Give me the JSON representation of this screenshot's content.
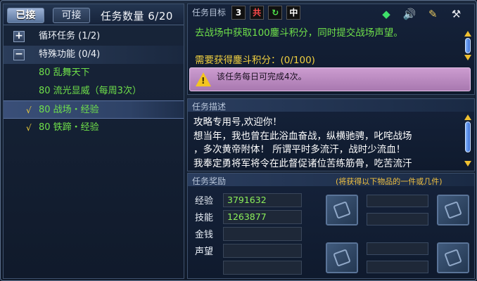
{
  "tabs": {
    "accepted": "已接",
    "available": "可接"
  },
  "task_count": "任务数量 6/20",
  "tree": {
    "groups": [
      {
        "toggle": "+",
        "label": "循环任务 (1/2)"
      },
      {
        "toggle": "−",
        "label": "特殊功能 (0/4)"
      }
    ],
    "quests": [
      {
        "check": "",
        "label": "80 乱舞天下"
      },
      {
        "check": "",
        "label": "80 流光显威（每周3次）"
      },
      {
        "check": "√",
        "label": "80 战场・经验"
      },
      {
        "check": "√",
        "label": "80 铁蹄・经验"
      }
    ]
  },
  "objective": {
    "label": "任务目标",
    "mode_icons": [
      "3",
      "共",
      "↻",
      "中"
    ],
    "text": "去战场中获取100鏖斗积分，同时提交战场声望。",
    "requirement": "需要获得鏖斗积分：(0/100)",
    "warning": "该任务每日可完成4次。"
  },
  "top_icons": [
    "gem-icon",
    "speaker-icon",
    "brush-icon",
    "tool-icon"
  ],
  "description": {
    "label": "任务描述",
    "lines": [
      "攻略专用号,欢迎你！",
      "想当年，我也曾在此浴血奋战，纵横驰骋，叱咤战场",
      "，多次黄帝附体！ 所谓平时多流汗，战时少流血！",
      "我奉定勇将军将令在此督促诸位苦练筋骨，吃苦流汗"
    ]
  },
  "reward": {
    "label": "任务奖励",
    "note": "(将获得以下物品的一件或几件)",
    "stats": [
      {
        "name": "经验",
        "value": "3791632"
      },
      {
        "name": "技能",
        "value": "1263877"
      },
      {
        "name": "金钱",
        "value": ""
      },
      {
        "name": "声望",
        "value": ""
      }
    ]
  },
  "colors": {
    "quest_green": "#6fe04a",
    "requirement_yellow": "#f0d040",
    "warning_bg": "#bb8ac0"
  }
}
